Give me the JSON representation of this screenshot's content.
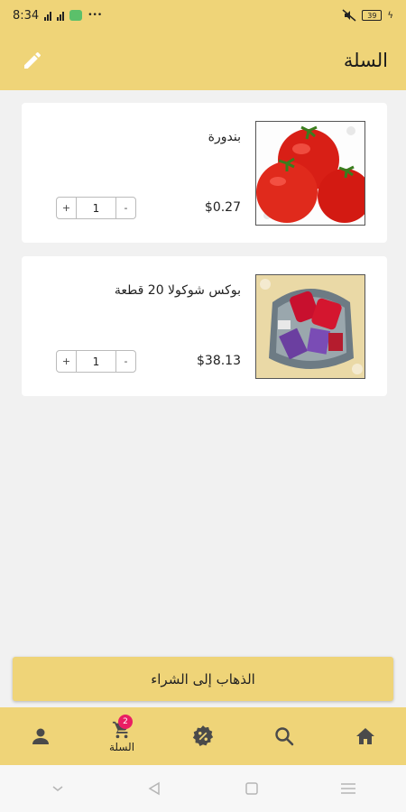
{
  "status_bar": {
    "time": "8:34",
    "battery": "39"
  },
  "header": {
    "title": "السلة"
  },
  "cart": {
    "items": [
      {
        "name": "بندورة",
        "price": "$0.27",
        "quantity": "1",
        "image": "tomatoes-image"
      },
      {
        "name": "بوكس شوكولا 20 قطعة",
        "price": "$38.13",
        "quantity": "1",
        "image": "chocolate-box-image"
      }
    ],
    "stepper": {
      "plus": "+",
      "minus": "-"
    }
  },
  "checkout": {
    "label": "الذهاب إلى الشراء"
  },
  "bottom_nav": {
    "items": [
      {
        "icon": "person-icon",
        "label": ""
      },
      {
        "icon": "cart-icon",
        "label": "السلة",
        "badge": "2"
      },
      {
        "icon": "discount-icon",
        "label": ""
      },
      {
        "icon": "search-icon",
        "label": ""
      },
      {
        "icon": "home-icon",
        "label": ""
      }
    ]
  },
  "colors": {
    "accent": "#efd478",
    "badge": "#e91e63"
  }
}
